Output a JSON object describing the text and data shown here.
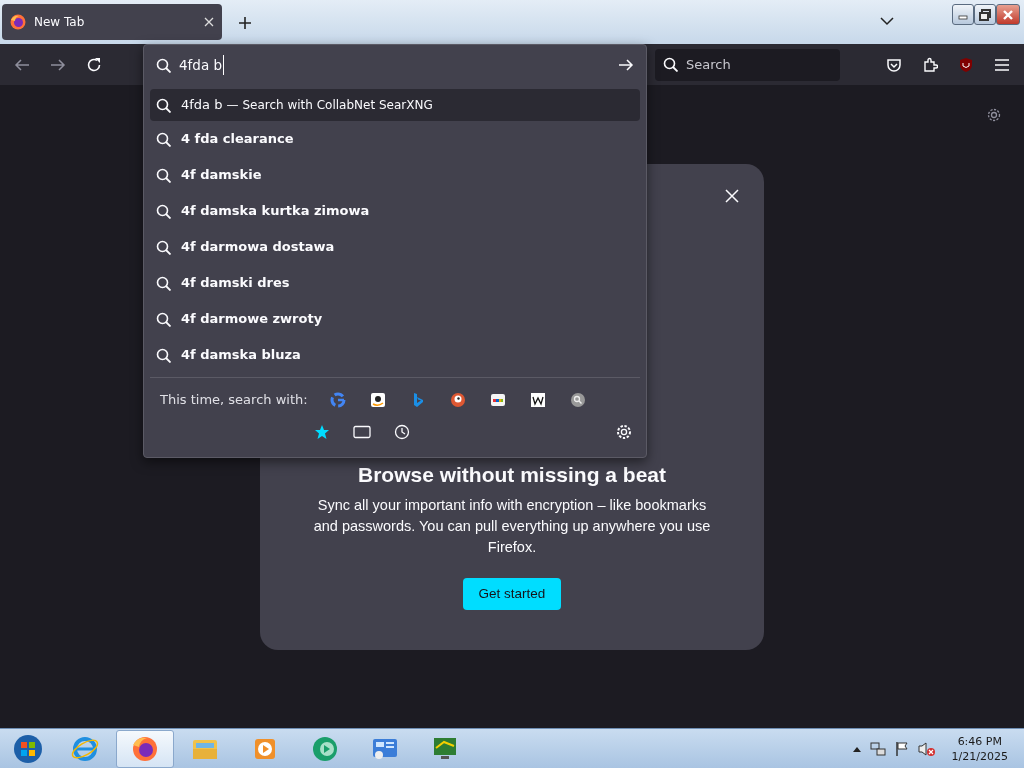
{
  "tabs": [
    {
      "title": "New Tab",
      "selected": true
    }
  ],
  "toolbar": {
    "search_placeholder": "Search"
  },
  "url_bar": {
    "value": "4fda b"
  },
  "dropdown": {
    "heuristic": {
      "query": "4fda b",
      "separator": "—",
      "action": "Search with CollabNet SearXNG",
      "selected": true
    },
    "suggestions": [
      {
        "text": "4 fda clearance",
        "selected": false
      },
      {
        "text": "4f damskie",
        "selected": false
      },
      {
        "text": "4f damska kurtka zimowa",
        "selected": false
      },
      {
        "text": "4f darmowa dostawa",
        "selected": false
      },
      {
        "text": "4f damski dres",
        "selected": false
      },
      {
        "text": "4f darmowe zwroty",
        "selected": false
      },
      {
        "text": "4f damska bluza",
        "selected": false
      }
    ],
    "engines_label": "This time, search with:"
  },
  "modal": {
    "title": "Browse without missing a beat",
    "body": "Sync all your important info with encryption – like bookmarks and passwords. You can pull everything up anywhere you use Firefox.",
    "button": "Get started"
  },
  "taskbar": {
    "time": "6:46 PM",
    "date": "1/21/2025"
  }
}
